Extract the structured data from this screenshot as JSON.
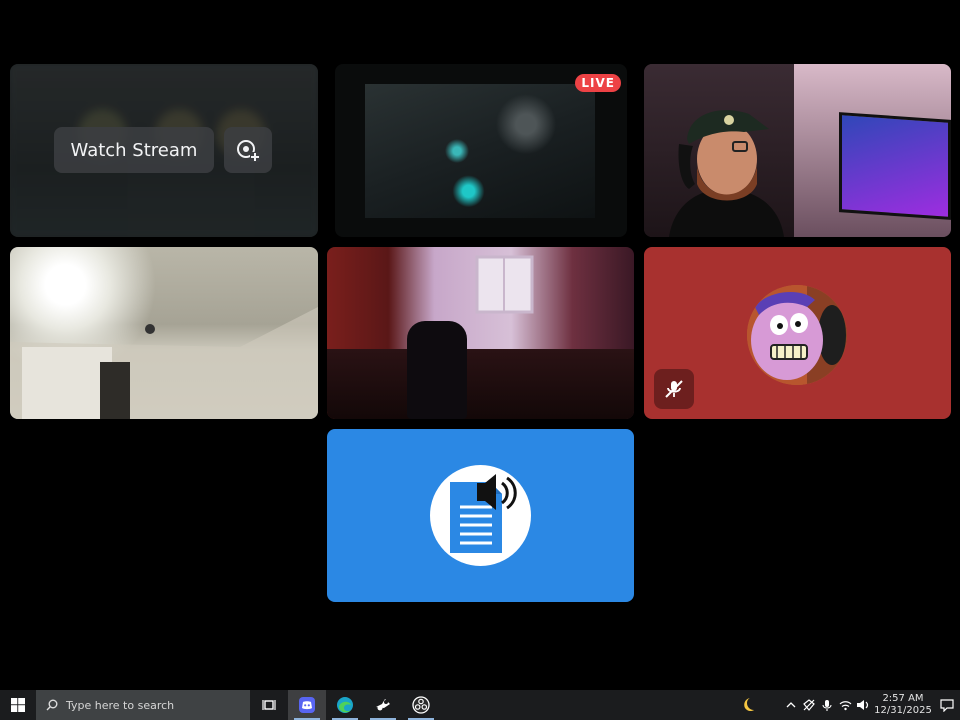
{
  "tiles": {
    "stream": {
      "watch_label": "Watch Stream"
    },
    "game": {
      "live_label": "LIVE"
    },
    "colors": {
      "live": "#ed4245",
      "avatar_bg": "#a8312f",
      "bot_bg": "#2b88e4"
    }
  },
  "taskbar": {
    "search_placeholder": "Type here to search",
    "apps": [
      "task-view",
      "discord",
      "edge",
      "steam",
      "obs"
    ],
    "time": "2:57 AM",
    "date": "12/31/2025"
  }
}
